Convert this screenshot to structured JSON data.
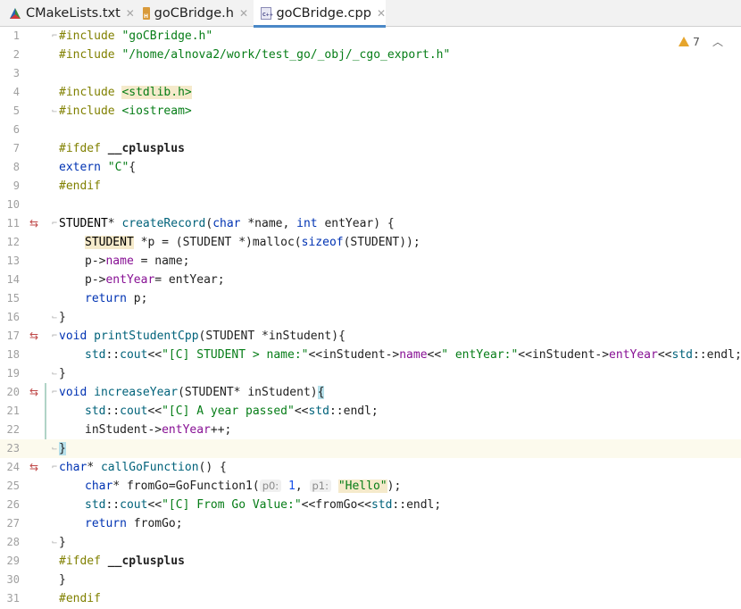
{
  "tabs": [
    {
      "label": "CMakeLists.txt",
      "icon": "cmake-icon",
      "active": false
    },
    {
      "label": "goCBridge.h",
      "icon": "header-file-icon",
      "active": false
    },
    {
      "label": "goCBridge.cpp",
      "icon": "cpp-file-icon",
      "active": true
    }
  ],
  "editor": {
    "warning_count": "7",
    "current_line": 23,
    "line_numbers": [
      "1",
      "2",
      "3",
      "4",
      "5",
      "6",
      "7",
      "8",
      "9",
      "10",
      "11",
      "12",
      "13",
      "14",
      "15",
      "16",
      "17",
      "18",
      "19",
      "20",
      "21",
      "22",
      "23",
      "24",
      "25",
      "26",
      "27",
      "28",
      "29",
      "30",
      "31"
    ],
    "inlay_hints": {
      "p0": "p0:",
      "p1": "p1:"
    }
  },
  "code": {
    "l1_dir": "#include ",
    "l1_str": "\"goCBridge.h\"",
    "l2_dir": "#include ",
    "l2_str": "\"/home/alnova2/work/test_go/_obj/_cgo_export.h\"",
    "l4_dir": "#include ",
    "l4_str": "<stdlib.h>",
    "l5_dir": "#include ",
    "l5_str": "<iostream>",
    "l7_dir": "#ifdef ",
    "l7_mac": "__cplusplus",
    "l8_kw": "extern ",
    "l8_str": "\"C\"",
    "l8_rest": "{",
    "l9_dir": "#endif",
    "l11_typ": "STUDENT",
    "l11_a": "* ",
    "l11_fn": "createRecord",
    "l11_b": "(",
    "l11_kw1": "char",
    "l11_c": " *name, ",
    "l11_kw2": "int",
    "l11_d": " entYear) {",
    "l12_typ": "STUDENT",
    "l12_a": " *p = (STUDENT *)malloc(",
    "l12_kw": "sizeof",
    "l12_b": "(STUDENT));",
    "l13_a": "p->",
    "l13_fld": "name",
    "l13_b": " = name;",
    "l14_a": "p->",
    "l14_fld": "entYear",
    "l14_b": "= entYear;",
    "l15_kw": "return",
    "l15_a": " p;",
    "l16": "}",
    "l17_kw": "void",
    "l17_fn": " printStudentCpp",
    "l17_a": "(STUDENT *inStudent){",
    "l18_ns": "std",
    "l18_a": "::",
    "l18_fn": "cout",
    "l18_b": "<<",
    "l18_str": "\"[C] STUDENT > name:\"",
    "l18_c": "<<inStudent->",
    "l18_fld": "name",
    "l18_d": "<<",
    "l18_str2": "\" entYear:\"",
    "l18_e": "<<inStudent->",
    "l18_fld2": "entYear",
    "l18_f": "<<",
    "l18_ns2": "std",
    "l18_g": "::endl;",
    "l19": "}",
    "l20_kw": "void",
    "l20_fn": " increaseYear",
    "l20_a": "(STUDENT* inStudent)",
    "l20_br": "{",
    "l21_ns": "std",
    "l21_a": "::",
    "l21_fn": "cout",
    "l21_b": "<<",
    "l21_str": "\"[C] A year passed\"",
    "l21_c": "<<",
    "l21_ns2": "std",
    "l21_d": "::endl;",
    "l22_a": "inStudent->",
    "l22_fld": "entYear",
    "l22_b": "++;",
    "l23_br": "}",
    "l24_kw": "char",
    "l24_a": "* ",
    "l24_fn": "callGoFunction",
    "l24_b": "() {",
    "l25_kw": "char",
    "l25_a": "* fromGo=GoFunction1(",
    "l25_n1": "1",
    "l25_b": ", ",
    "l25_str": "\"Hello\"",
    "l25_c": ");",
    "l26_ns": "std",
    "l26_a": "::",
    "l26_fn": "cout",
    "l26_b": "<<",
    "l26_str": "\"[C] From Go Value:\"",
    "l26_c": "<<fromGo<<",
    "l26_ns2": "std",
    "l26_d": "::endl;",
    "l27_kw": "return",
    "l27_a": " fromGo;",
    "l28": "}",
    "l29_dir": "#ifdef ",
    "l29_mac": "__cplusplus",
    "l30": "}",
    "l31_dir": "#endif"
  },
  "colors": {
    "keyword": "#0033b3",
    "string": "#067d17",
    "preprocessor": "#808000",
    "field": "#871094",
    "function": "#00627a",
    "warning": "#e6a52c",
    "current_line_bg": "#fcfaed"
  }
}
